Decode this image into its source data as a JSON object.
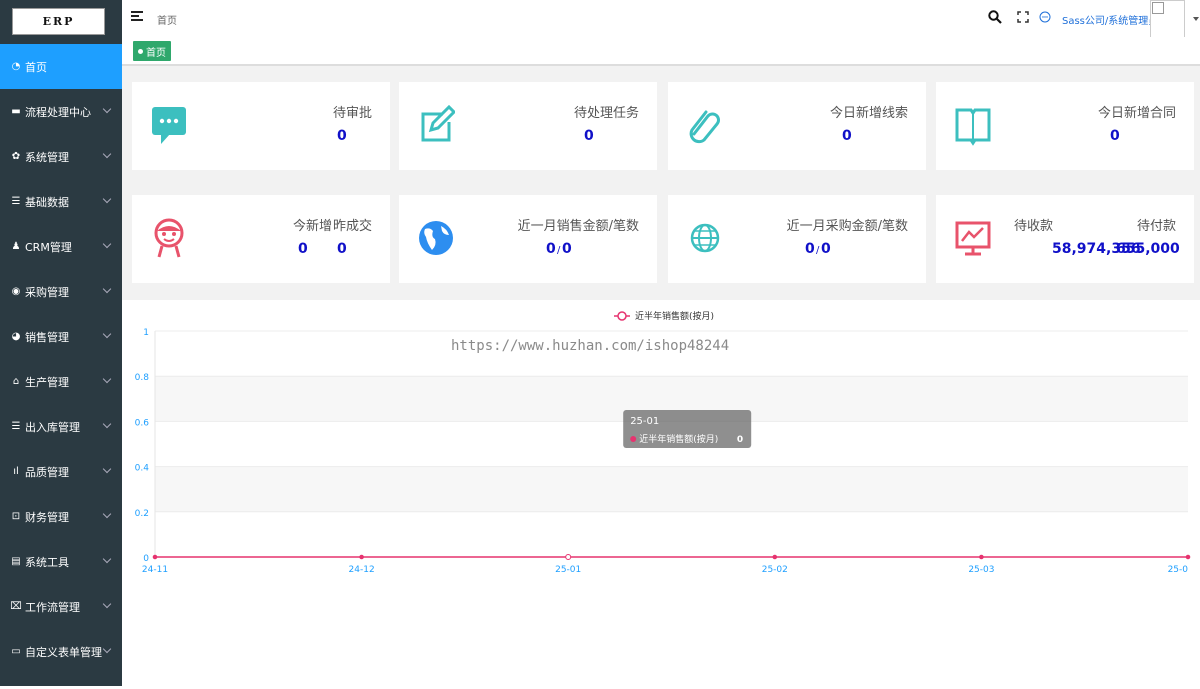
{
  "app": {
    "logo_text": "ERP"
  },
  "sidebar": {
    "items": [
      {
        "label": "首页",
        "icon": "dashboard-icon",
        "glyph": "◔",
        "active": true,
        "has_arrow": false
      },
      {
        "label": "流程处理中心",
        "icon": "message-icon",
        "glyph": "▬",
        "active": false,
        "has_arrow": true
      },
      {
        "label": "系统管理",
        "icon": "gear-icon",
        "glyph": "✿",
        "active": false,
        "has_arrow": true
      },
      {
        "label": "基础数据",
        "icon": "database-icon",
        "glyph": "☰",
        "active": false,
        "has_arrow": true
      },
      {
        "label": "CRM管理",
        "icon": "users-icon",
        "glyph": "♟",
        "active": false,
        "has_arrow": true
      },
      {
        "label": "采购管理",
        "icon": "globe-icon",
        "glyph": "◉",
        "active": false,
        "has_arrow": true
      },
      {
        "label": "销售管理",
        "icon": "earth-icon",
        "glyph": "◕",
        "active": false,
        "has_arrow": true
      },
      {
        "label": "生产管理",
        "icon": "factory-icon",
        "glyph": "⌂",
        "active": false,
        "has_arrow": true
      },
      {
        "label": "出入库管理",
        "icon": "warehouse-icon",
        "glyph": "☰",
        "active": false,
        "has_arrow": true
      },
      {
        "label": "品质管理",
        "icon": "quality-icon",
        "glyph": "ıl",
        "active": false,
        "has_arrow": true
      },
      {
        "label": "财务管理",
        "icon": "finance-icon",
        "glyph": "⊡",
        "active": false,
        "has_arrow": true
      },
      {
        "label": "系统工具",
        "icon": "toolbox-icon",
        "glyph": "▤",
        "active": false,
        "has_arrow": true
      },
      {
        "label": "工作流管理",
        "icon": "workflow-icon",
        "glyph": "⌧",
        "active": false,
        "has_arrow": true
      },
      {
        "label": "自定义表单管理",
        "icon": "form-icon",
        "glyph": "▭",
        "active": false,
        "has_arrow": true
      }
    ]
  },
  "header": {
    "breadcrumb": "首页",
    "user_label": "Sass公司/系统管理员"
  },
  "tabs": [
    {
      "label": "首页"
    }
  ],
  "cards": {
    "pending_approval": {
      "title": "待审批",
      "value": "0"
    },
    "pending_tasks": {
      "title": "待处理任务",
      "value": "0"
    },
    "new_leads_today": {
      "title": "今日新增线索",
      "value": "0"
    },
    "new_contracts_today": {
      "title": "今日新增合同",
      "value": "0"
    },
    "today_stats": {
      "title_new": "今新增",
      "title_deal": "昨成交",
      "value_new": "0",
      "value_deal": "0"
    },
    "monthly_sales": {
      "title": "近一月销售金额/笔数",
      "amount": "0",
      "separator": "/",
      "count": "0"
    },
    "monthly_purchase": {
      "title": "近一月采购金额/笔数",
      "amount": "0",
      "separator": "/",
      "count": "0"
    },
    "receivables_payables": {
      "title_recv": "待收款",
      "title_pay": "待付款",
      "value_recv": "58,974,356",
      "value_pay": "655,000"
    }
  },
  "colors": {
    "sidebar_bg": "#2b3a42",
    "active_blue": "#1e9fff",
    "tab_green": "#2fa86c",
    "icon_teal": "#3cbfbf",
    "icon_pink": "#e8536b",
    "globe_blue": "#2d8ef0",
    "value_blue": "#1010c8",
    "series_pink": "#e6336f"
  },
  "watermark": "https://www.huzhan.com/ishop48244",
  "chart_data": {
    "type": "line",
    "x": [
      "24-11",
      "24-12",
      "25-01",
      "25-02",
      "25-03",
      "25-0"
    ],
    "series": [
      {
        "name": "近半年销售额(按月)",
        "values": [
          0,
          0,
          0,
          0,
          0,
          0
        ]
      }
    ],
    "yticks": [
      "0",
      "0.2",
      "0.4",
      "0.6",
      "0.8",
      "1"
    ],
    "ylim": [
      0,
      1
    ],
    "legend": "top-center",
    "grid": true,
    "tooltip": {
      "title": "25-01",
      "series": "近半年销售额(按月)",
      "value": "0"
    }
  }
}
